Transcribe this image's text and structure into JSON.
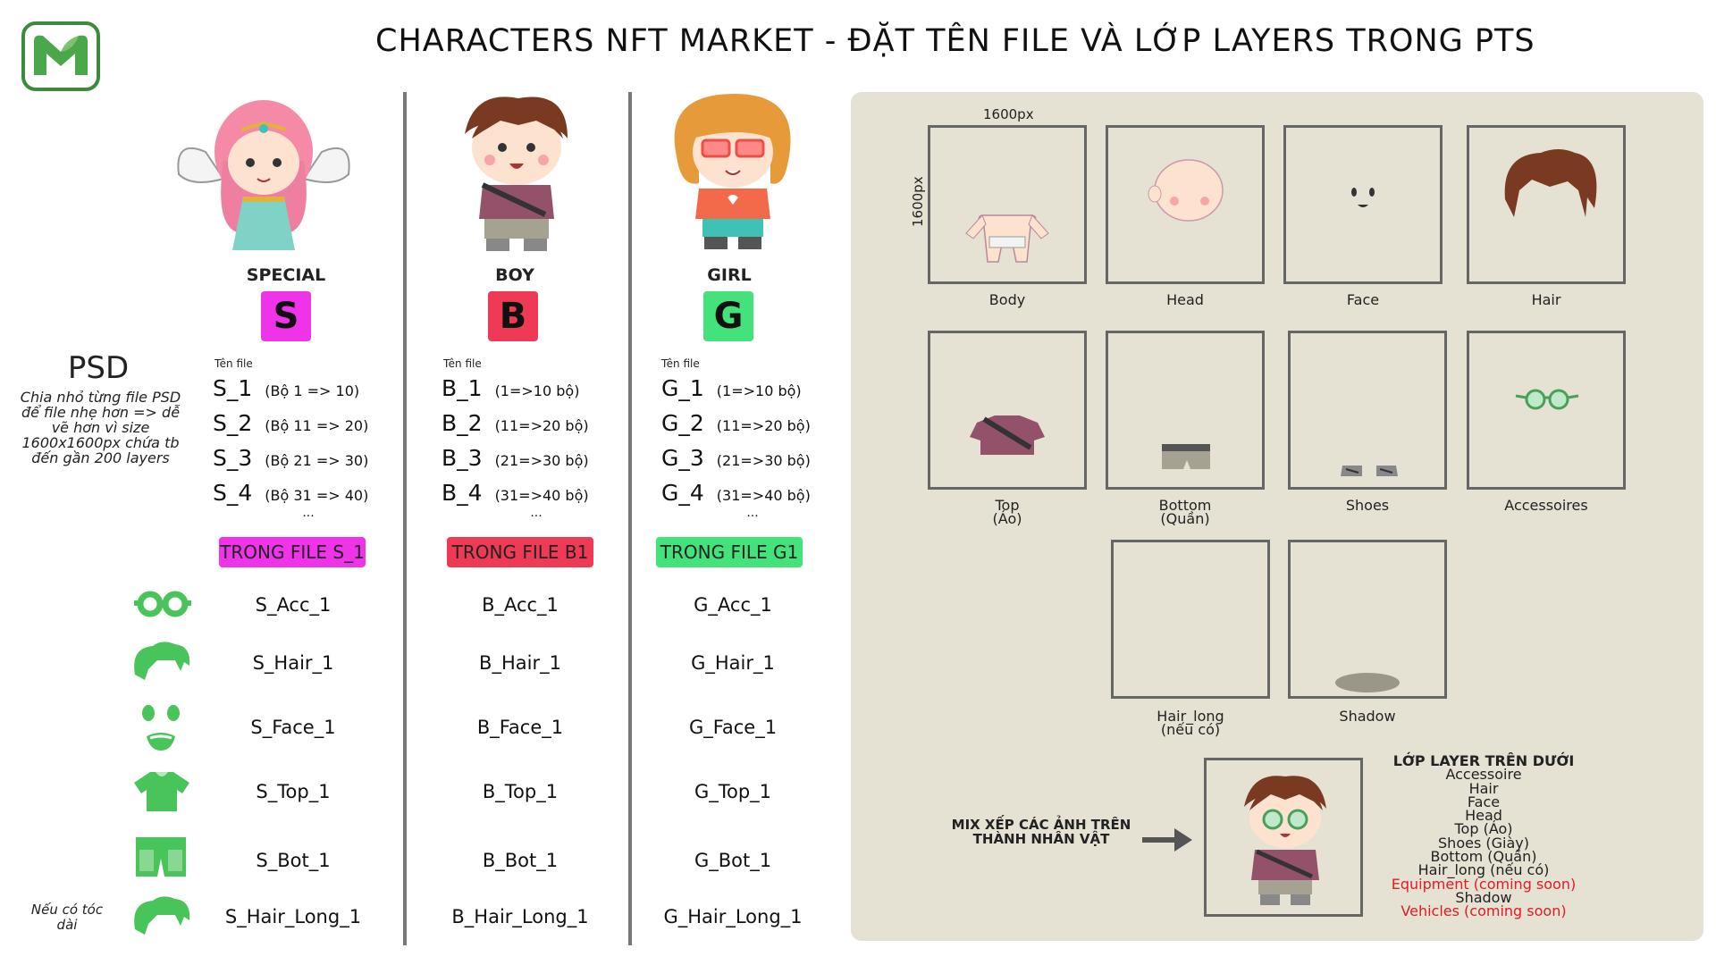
{
  "title": "CHARACTERS NFT MARKET - ĐẶT TÊN FILE VÀ LỚP LAYERS TRONG PTS",
  "colors": {
    "special": "#ee33e8",
    "boy": "#ee3a55",
    "girl": "#44e27a",
    "icon_green": "#49c45a",
    "panel_bg": "#e5e1d3",
    "red_text": "#e01b24"
  },
  "psd": {
    "title": "PSD",
    "description": "Chia nhỏ từng file PSD để file nhẹ hơn => dễ vẽ hơn vì size 1600x1600px chứa tb đến gần 200 layers"
  },
  "columns": [
    {
      "name": "SPECIAL",
      "letter": "S",
      "filename_label": "Tên file",
      "files": [
        {
          "code": "S_1",
          "range": "(Bộ 1 => 10)"
        },
        {
          "code": "S_2",
          "range": "(Bộ 11 => 20)"
        },
        {
          "code": "S_3",
          "range": "(Bộ 21 => 30)"
        },
        {
          "code": "S_4",
          "range": "(Bộ 31 => 40)"
        }
      ],
      "ellipsis": "...",
      "tag": "TRONG FILE S_1",
      "layers": [
        "S_Acc_1",
        "S_Hair_1",
        "S_Face_1",
        "S_Top_1",
        "S_Bot_1",
        "S_Hair_Long_1"
      ]
    },
    {
      "name": "BOY",
      "letter": "B",
      "filename_label": "Tên file",
      "files": [
        {
          "code": "B_1",
          "range": "(1=>10 bộ)"
        },
        {
          "code": "B_2",
          "range": "(11=>20 bộ)"
        },
        {
          "code": "B_3",
          "range": "(21=>30 bộ)"
        },
        {
          "code": "B_4",
          "range": "(31=>40 bộ)"
        }
      ],
      "ellipsis": "...",
      "tag": "TRONG FILE B1",
      "layers": [
        "B_Acc_1",
        "B_Hair_1",
        "B_Face_1",
        "B_Top_1",
        "B_Bot_1",
        "B_Hair_Long_1"
      ]
    },
    {
      "name": "GIRL",
      "letter": "G",
      "filename_label": "Tên file",
      "files": [
        {
          "code": "G_1",
          "range": "(1=>10 bộ)"
        },
        {
          "code": "G_2",
          "range": "(11=>20 bộ)"
        },
        {
          "code": "G_3",
          "range": "(21=>30 bộ)"
        },
        {
          "code": "G_4",
          "range": "(31=>40 bộ)"
        }
      ],
      "ellipsis": "...",
      "tag": "TRONG FILE G1",
      "layers": [
        "G_Acc_1",
        "G_Hair_1",
        "G_Face_1",
        "G_Top_1",
        "G_Bot_1",
        "G_Hair_Long_1"
      ]
    }
  ],
  "row_icons": [
    "glasses-icon",
    "hair-icon",
    "face-icon",
    "shirt-icon",
    "shorts-icon",
    "long-hair-icon"
  ],
  "hair_long_note": "Nếu có tóc dài",
  "panel": {
    "width_label": "1600px",
    "height_label": "1600px",
    "parts": [
      {
        "label": "Body"
      },
      {
        "label": "Head"
      },
      {
        "label": "Face"
      },
      {
        "label": "Hair"
      },
      {
        "label": "Top",
        "sub": "(Áo)"
      },
      {
        "label": "Bottom",
        "sub": "(Quần)"
      },
      {
        "label": "Shoes"
      },
      {
        "label": "Accessoires"
      },
      {
        "label": "Hair_long",
        "sub": "(nếu có)"
      },
      {
        "label": "Shadow"
      }
    ],
    "mix_text": "MIX XẾP CÁC ẢNH TRÊN THÀNH NHÂN VẬT",
    "order_title": "LỚP LAYER TRÊN DƯỚI",
    "order": [
      {
        "text": "Accessoire",
        "red": false
      },
      {
        "text": "Hair",
        "red": false
      },
      {
        "text": "Face",
        "red": false
      },
      {
        "text": "Head",
        "red": false
      },
      {
        "text": "Top (Áo)",
        "red": false
      },
      {
        "text": "Shoes (Giày)",
        "red": false
      },
      {
        "text": "Bottom (Quần)",
        "red": false
      },
      {
        "text": "Hair_long (nếu có)",
        "red": false
      },
      {
        "text": "Equipment (coming soon)",
        "red": true
      },
      {
        "text": "Shadow",
        "red": false
      },
      {
        "text": "Vehicles (coming soon)",
        "red": true
      }
    ]
  }
}
